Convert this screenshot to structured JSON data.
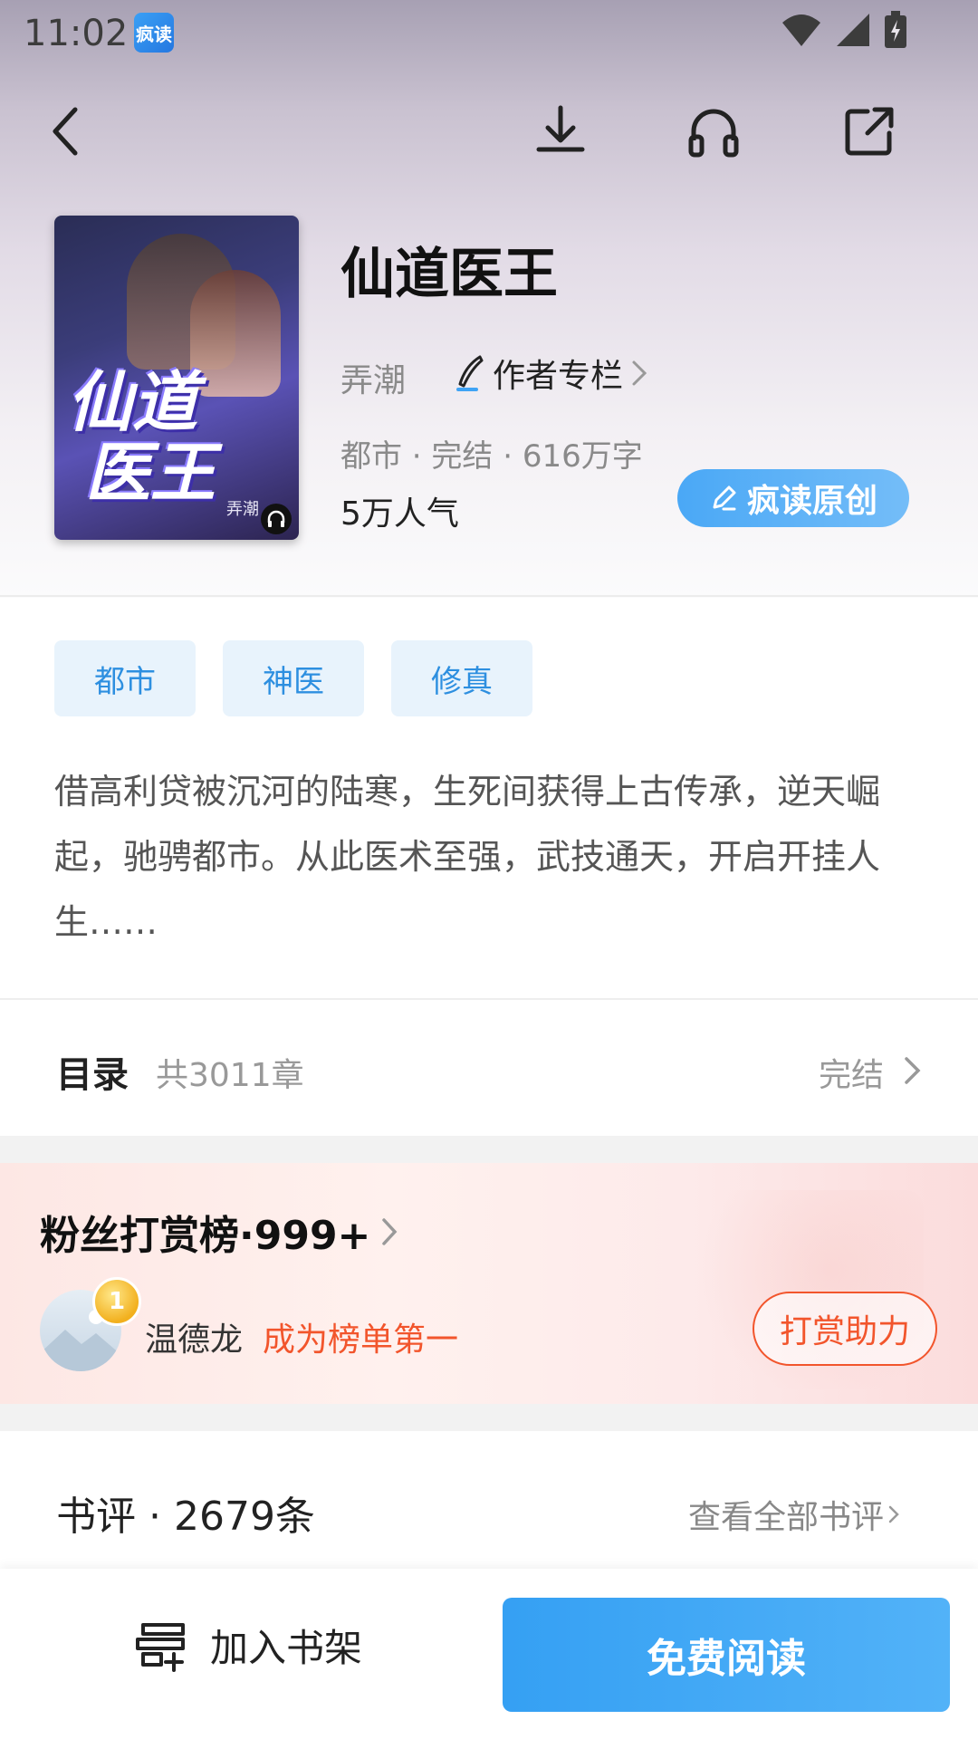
{
  "status_bar": {
    "time": "11:02",
    "app_badge": "疯读"
  },
  "nav": {
    "back": "back-icon",
    "download": "download-icon",
    "listen": "headphones-icon",
    "share": "share-icon"
  },
  "book": {
    "cover_title_line1": "仙道",
    "cover_title_line2": "医王",
    "cover_author": "弄潮",
    "title": "仙道医王",
    "author": "弄潮",
    "author_column": "作者专栏",
    "meta": "都市 · 完结 · 616万字",
    "popularity": "5万人气",
    "badge": "疯读原创"
  },
  "tags": [
    "都市",
    "神医",
    "修真"
  ],
  "synopsis": "借高利贷被沉河的陆寒，生死间获得上古传承，逆天崛起，驰骋都市。从此医术至强，武技通天，开启开挂人生……",
  "catalog": {
    "label": "目录",
    "count": "共3011章",
    "status": "完结"
  },
  "fans": {
    "title": "粉丝打赏榜·999+",
    "rank": "1",
    "top_fan": "温德龙",
    "slogan": "成为榜单第一",
    "reward_button": "打赏助力"
  },
  "reviews": {
    "title": "书评 · 2679条",
    "view_all": "查看全部书评"
  },
  "bottom": {
    "add_shelf": "加入书架",
    "read_free": "免费阅读"
  },
  "colors": {
    "accent_blue": "#35a0f3",
    "accent_red": "#f2552c",
    "tag_bg": "#e8f3fc"
  }
}
